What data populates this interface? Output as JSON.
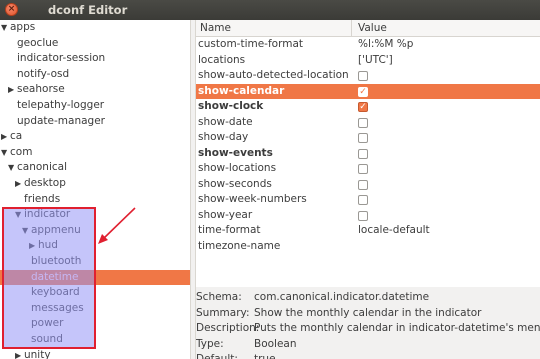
{
  "window": {
    "title": "dconf Editor",
    "close_glyph": "×"
  },
  "tree": [
    {
      "label": "apps",
      "arrow": "▼",
      "indent": 0,
      "selected": false
    },
    {
      "label": "geoclue",
      "arrow": "",
      "indent": 1,
      "selected": false
    },
    {
      "label": "indicator-session",
      "arrow": "",
      "indent": 1,
      "selected": false
    },
    {
      "label": "notify-osd",
      "arrow": "",
      "indent": 1,
      "selected": false
    },
    {
      "label": "seahorse",
      "arrow": "▶",
      "indent": 1,
      "selected": false
    },
    {
      "label": "telepathy-logger",
      "arrow": "",
      "indent": 1,
      "selected": false
    },
    {
      "label": "update-manager",
      "arrow": "",
      "indent": 1,
      "selected": false
    },
    {
      "label": "ca",
      "arrow": "▶",
      "indent": 0,
      "selected": false
    },
    {
      "label": "com",
      "arrow": "▼",
      "indent": 0,
      "selected": false
    },
    {
      "label": "canonical",
      "arrow": "▼",
      "indent": 1,
      "selected": false
    },
    {
      "label": "desktop",
      "arrow": "▶",
      "indent": 2,
      "selected": false
    },
    {
      "label": "friends",
      "arrow": "",
      "indent": 2,
      "selected": false
    },
    {
      "label": "indicator",
      "arrow": "▼",
      "indent": 2,
      "selected": false
    },
    {
      "label": "appmenu",
      "arrow": "▼",
      "indent": 3,
      "selected": false
    },
    {
      "label": "hud",
      "arrow": "▶",
      "indent": 4,
      "selected": false
    },
    {
      "label": "bluetooth",
      "arrow": "",
      "indent": 3,
      "selected": false
    },
    {
      "label": "datetime",
      "arrow": "",
      "indent": 3,
      "selected": true
    },
    {
      "label": "keyboard",
      "arrow": "",
      "indent": 3,
      "selected": false
    },
    {
      "label": "messages",
      "arrow": "",
      "indent": 3,
      "selected": false
    },
    {
      "label": "power",
      "arrow": "",
      "indent": 3,
      "selected": false
    },
    {
      "label": "sound",
      "arrow": "",
      "indent": 3,
      "selected": false
    },
    {
      "label": "unity",
      "arrow": "▶",
      "indent": 2,
      "selected": false
    }
  ],
  "keys_header": {
    "name": "Name",
    "value": "Value"
  },
  "keys": [
    {
      "name": "custom-time-format",
      "kind": "text",
      "value": "%l:%M %p",
      "bold": false,
      "selected": false
    },
    {
      "name": "locations",
      "kind": "text",
      "value": "['UTC']",
      "bold": false,
      "selected": false
    },
    {
      "name": "show-auto-detected-location",
      "kind": "check",
      "checked": false,
      "bold": false,
      "selected": false
    },
    {
      "name": "show-calendar",
      "kind": "check",
      "checked": true,
      "bold": true,
      "selected": true
    },
    {
      "name": "show-clock",
      "kind": "check",
      "checked": true,
      "bold": true,
      "selected": false
    },
    {
      "name": "show-date",
      "kind": "check",
      "checked": false,
      "bold": false,
      "selected": false
    },
    {
      "name": "show-day",
      "kind": "check",
      "checked": false,
      "bold": false,
      "selected": false
    },
    {
      "name": "show-events",
      "kind": "check",
      "checked": false,
      "bold": true,
      "selected": false
    },
    {
      "name": "show-locations",
      "kind": "check",
      "checked": false,
      "bold": false,
      "selected": false
    },
    {
      "name": "show-seconds",
      "kind": "check",
      "checked": false,
      "bold": false,
      "selected": false
    },
    {
      "name": "show-week-numbers",
      "kind": "check",
      "checked": false,
      "bold": false,
      "selected": false
    },
    {
      "name": "show-year",
      "kind": "check",
      "checked": false,
      "bold": false,
      "selected": false
    },
    {
      "name": "time-format",
      "kind": "text",
      "value": "locale-default",
      "bold": false,
      "selected": false
    },
    {
      "name": "timezone-name",
      "kind": "text",
      "value": "",
      "bold": false,
      "selected": false
    }
  ],
  "details": [
    {
      "label": "Schema:",
      "value": "com.canonical.indicator.datetime"
    },
    {
      "label": "Summary:",
      "value": "Show the monthly calendar in the indicator"
    },
    {
      "label": "Description:",
      "value": "Puts the monthly calendar in indicator-datetime's menu."
    },
    {
      "label": "Type:",
      "value": "Boolean"
    },
    {
      "label": "Default:",
      "value": "true"
    }
  ],
  "check_glyph": "✓",
  "colors": {
    "selection": "#f07746",
    "highlight_box": "#e02030",
    "highlight_fill": "#9696f5"
  }
}
